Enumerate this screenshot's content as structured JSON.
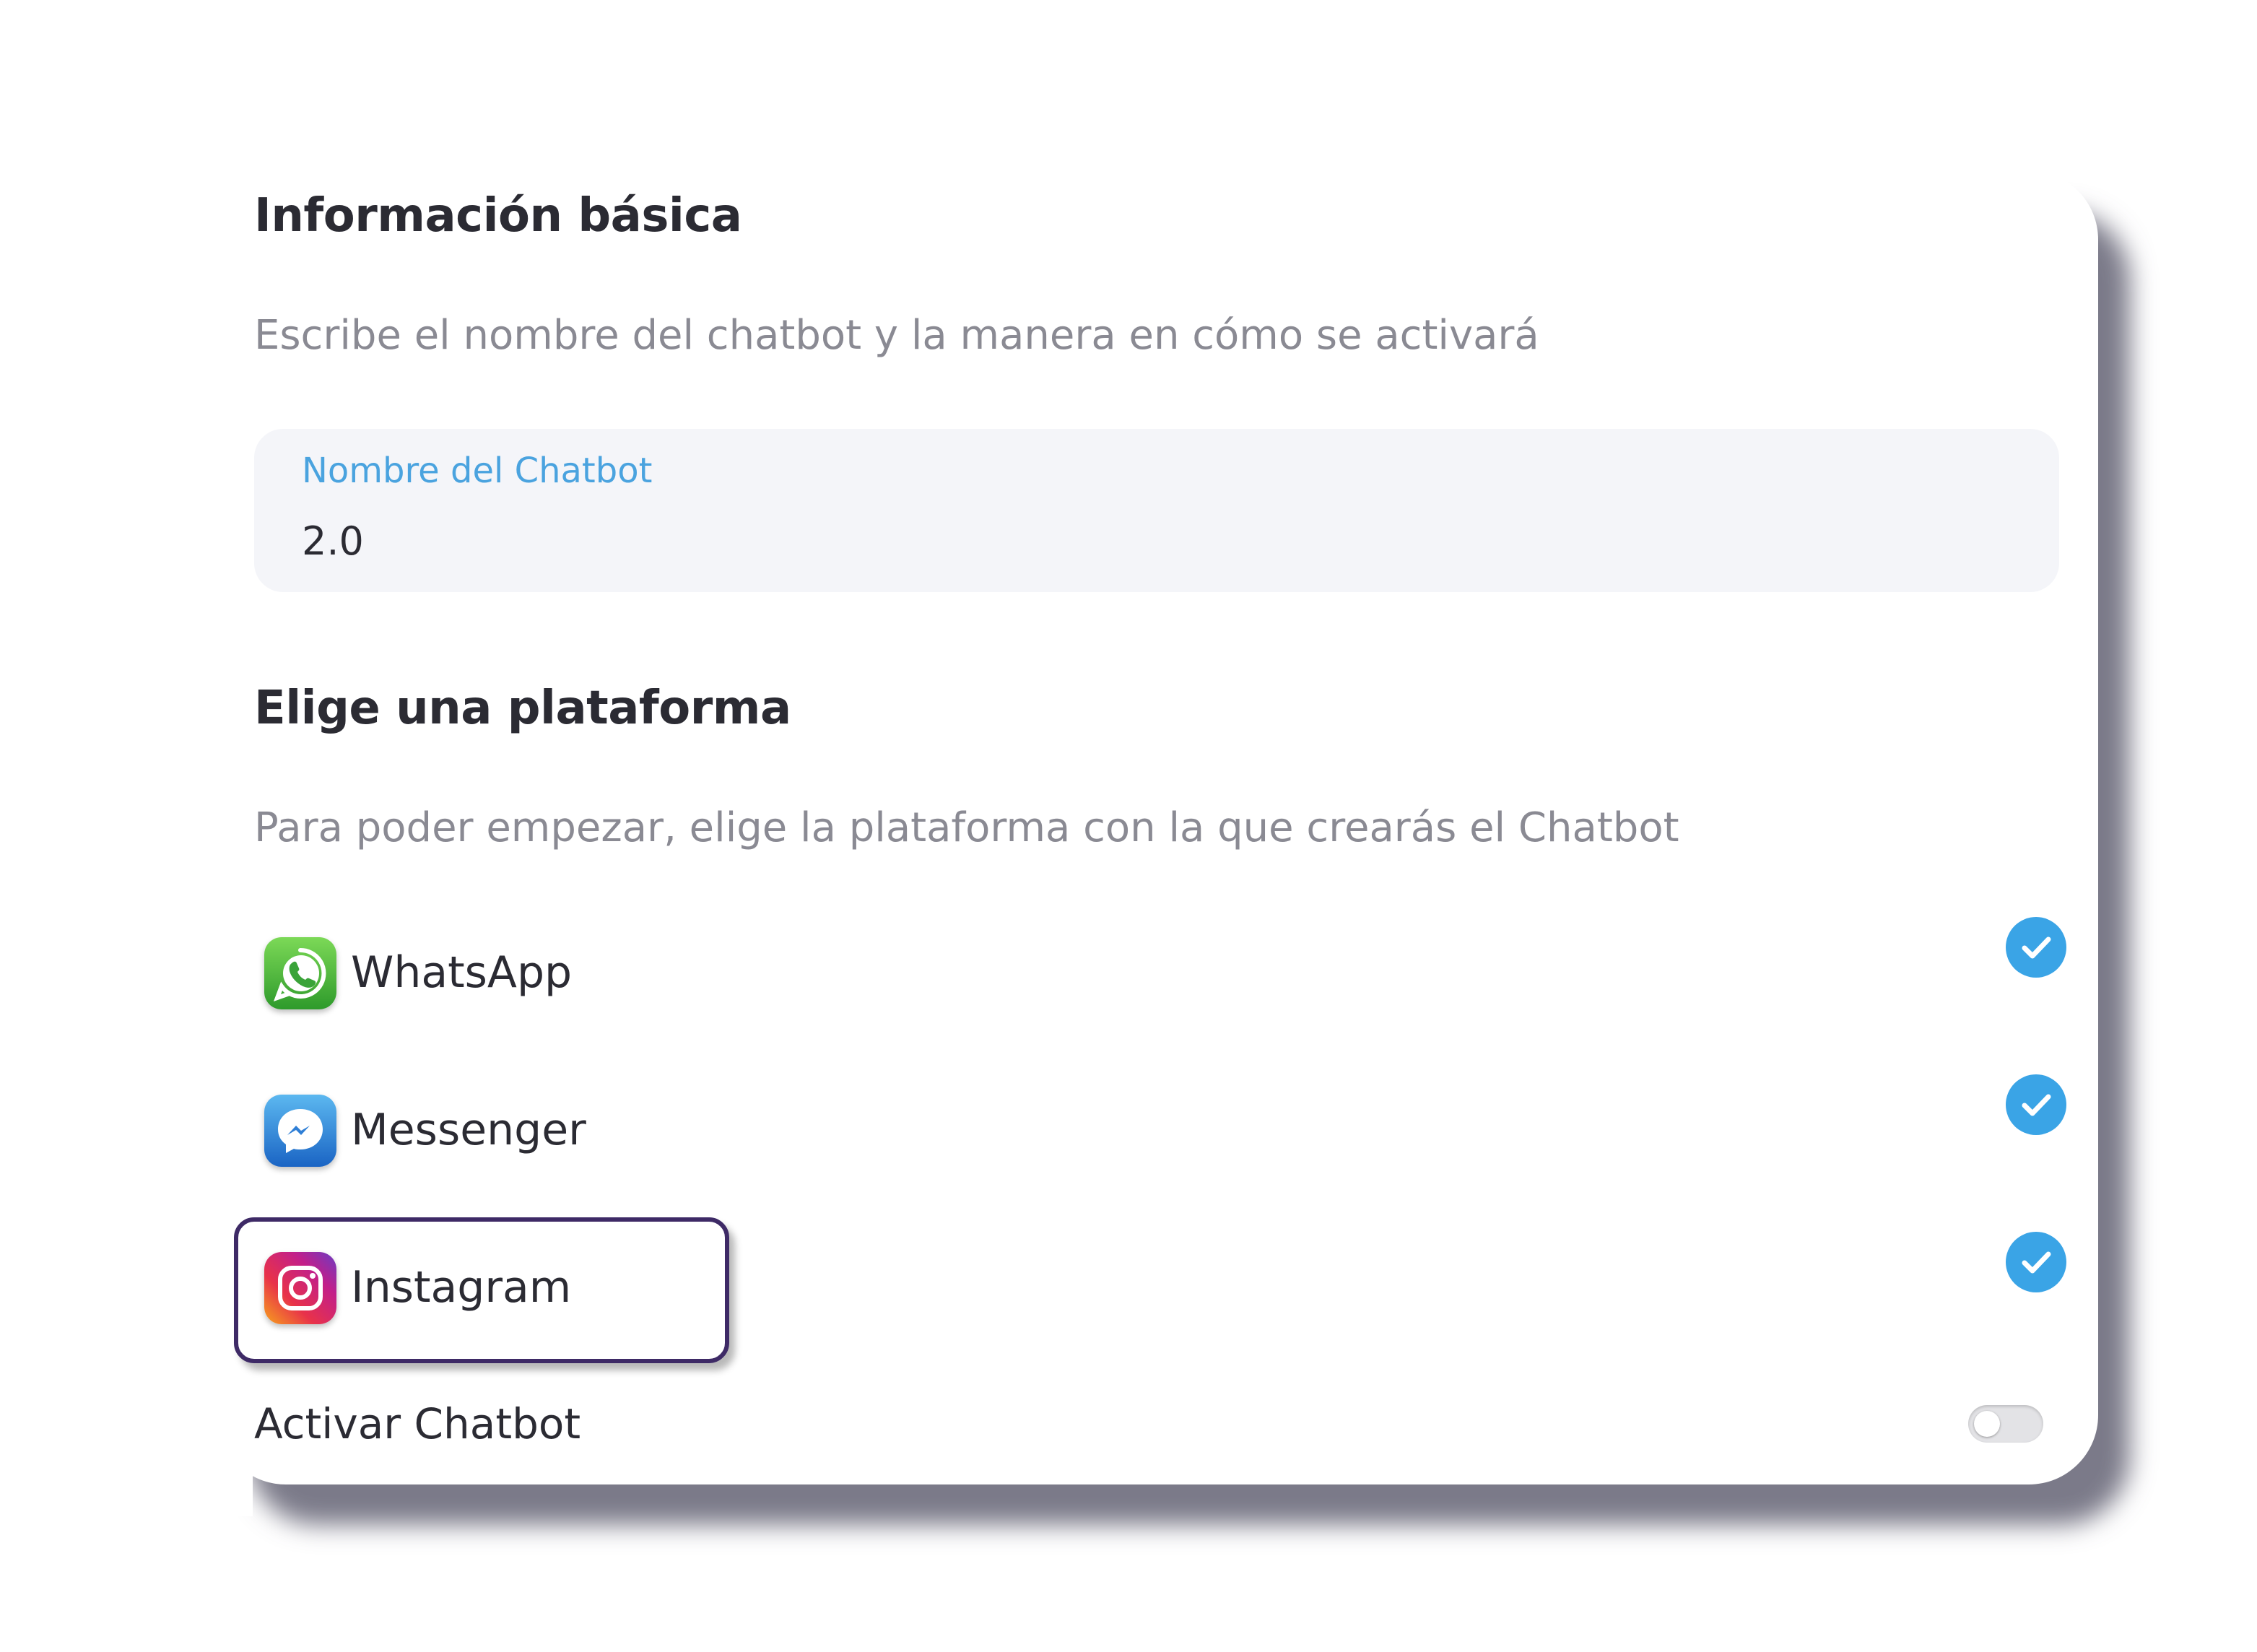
{
  "basic_info": {
    "title": "Información básica",
    "subtitle": "Escribe el nombre del chatbot y la manera en cómo se activará",
    "name_field": {
      "label": "Nombre del Chatbot",
      "value": "2.0"
    }
  },
  "platform": {
    "title": "Elige una plataforma",
    "subtitle": "Para poder empezar, elige la plataforma con la que crearás el Chatbot",
    "options": [
      {
        "label": "WhatsApp",
        "icon": "whatsapp-icon",
        "selected": true
      },
      {
        "label": "Messenger",
        "icon": "messenger-icon",
        "selected": true
      },
      {
        "label": "Instagram",
        "icon": "instagram-icon",
        "selected": true,
        "highlighted": true
      }
    ]
  },
  "activate": {
    "label": "Activar Chatbot",
    "enabled": false
  },
  "colors": {
    "accent": "#3aa4e6",
    "field_label": "#4aa3df",
    "highlight_border": "#3e2a66",
    "text": "#2b2b33",
    "muted_text": "#8a8a93"
  }
}
